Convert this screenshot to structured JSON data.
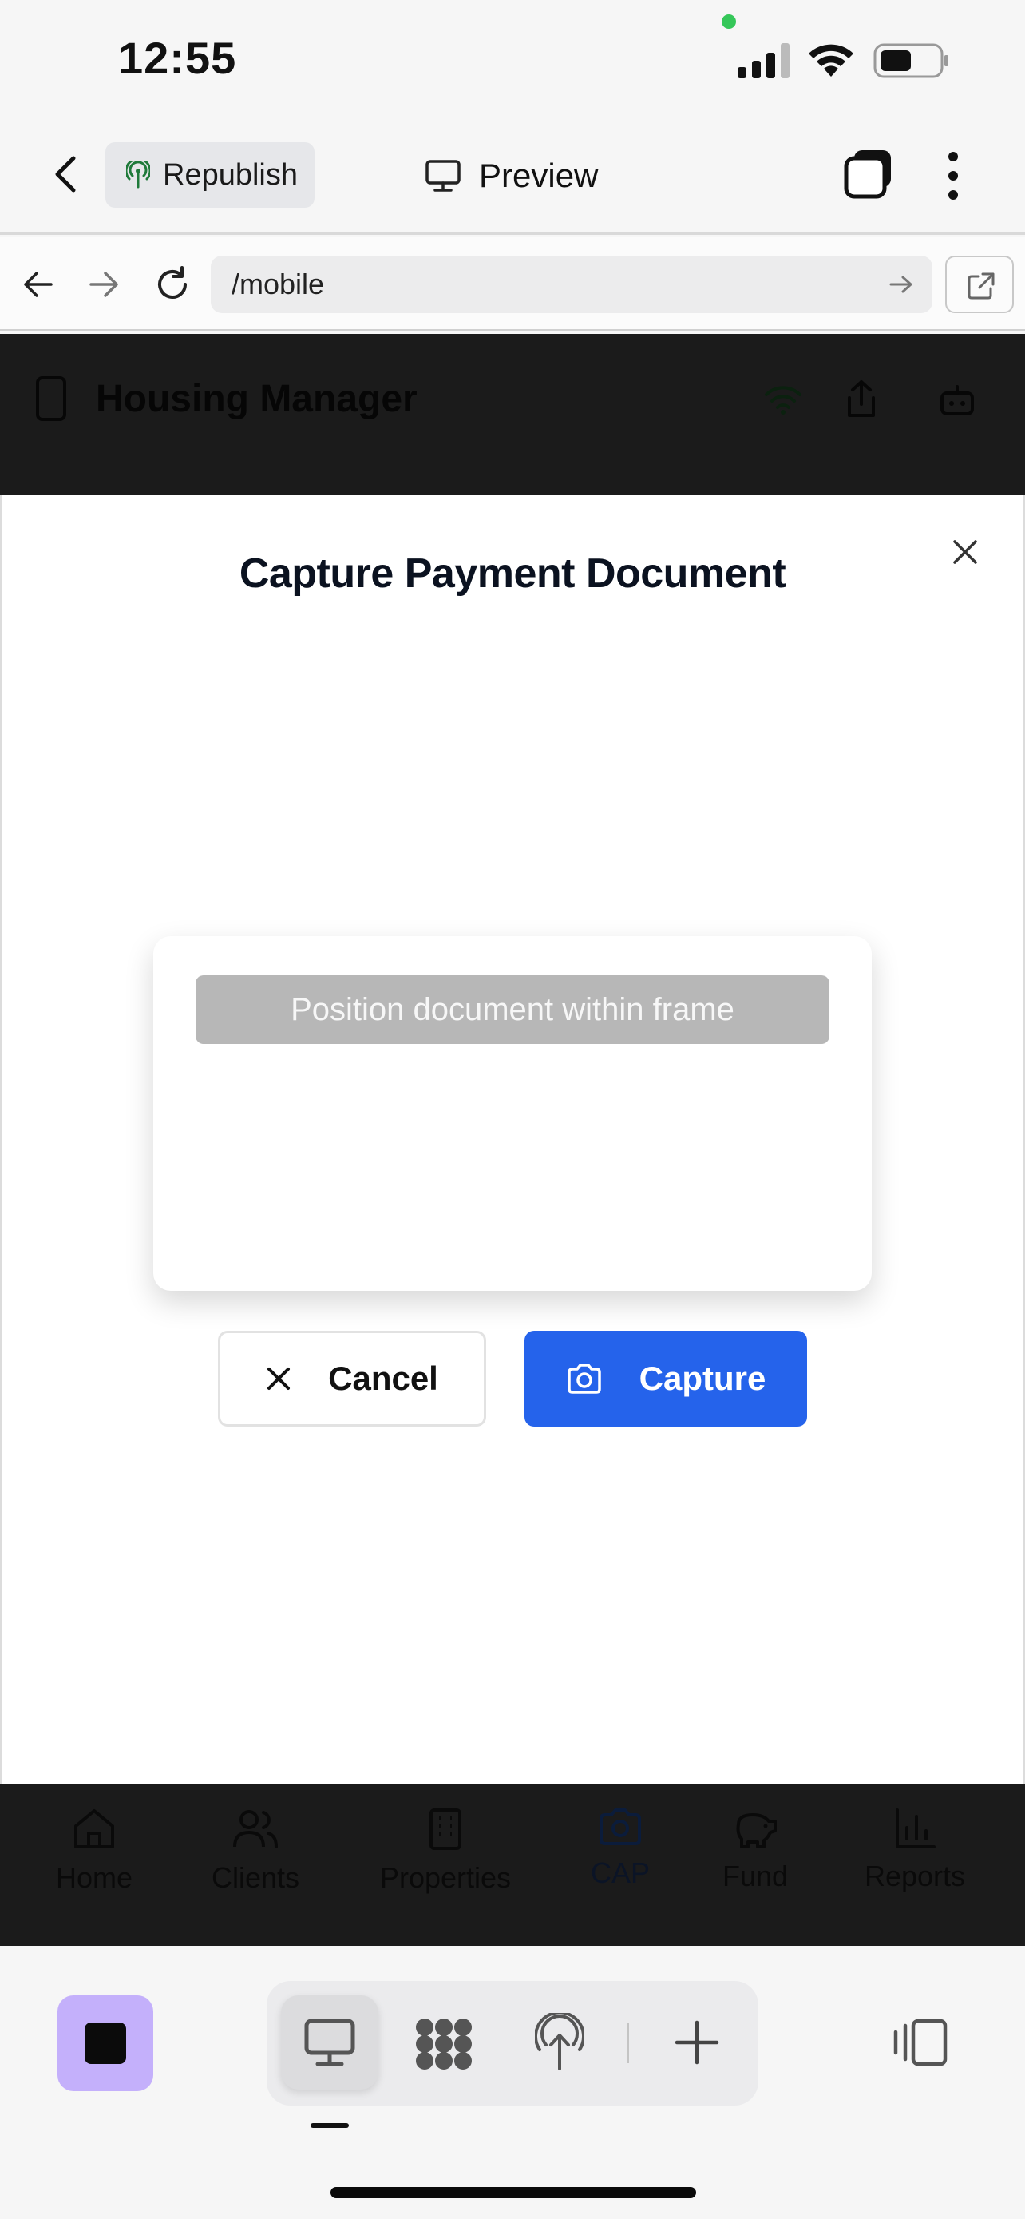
{
  "status_bar": {
    "time": "12:55"
  },
  "top_bar": {
    "republish_label": "Republish",
    "preview_label": "Preview"
  },
  "url_bar": {
    "url": "/mobile"
  },
  "app": {
    "title": "Housing Manager"
  },
  "modal": {
    "title": "Capture Payment Document",
    "frame_hint": "Position document within frame",
    "cancel_label": "Cancel",
    "capture_label": "Capture"
  },
  "tabs": [
    {
      "label": "Home",
      "icon": "home-icon"
    },
    {
      "label": "Clients",
      "icon": "users-icon"
    },
    {
      "label": "Properties",
      "icon": "building-icon"
    },
    {
      "label": "CAP",
      "icon": "camera-icon",
      "active": true
    },
    {
      "label": "Fund",
      "icon": "piggy-bank-icon"
    },
    {
      "label": "Reports",
      "icon": "bar-chart-icon"
    }
  ],
  "colors": {
    "accent": "#2563eb",
    "launcher": "#c4b0fb",
    "overlay": "#1b1b1b"
  }
}
